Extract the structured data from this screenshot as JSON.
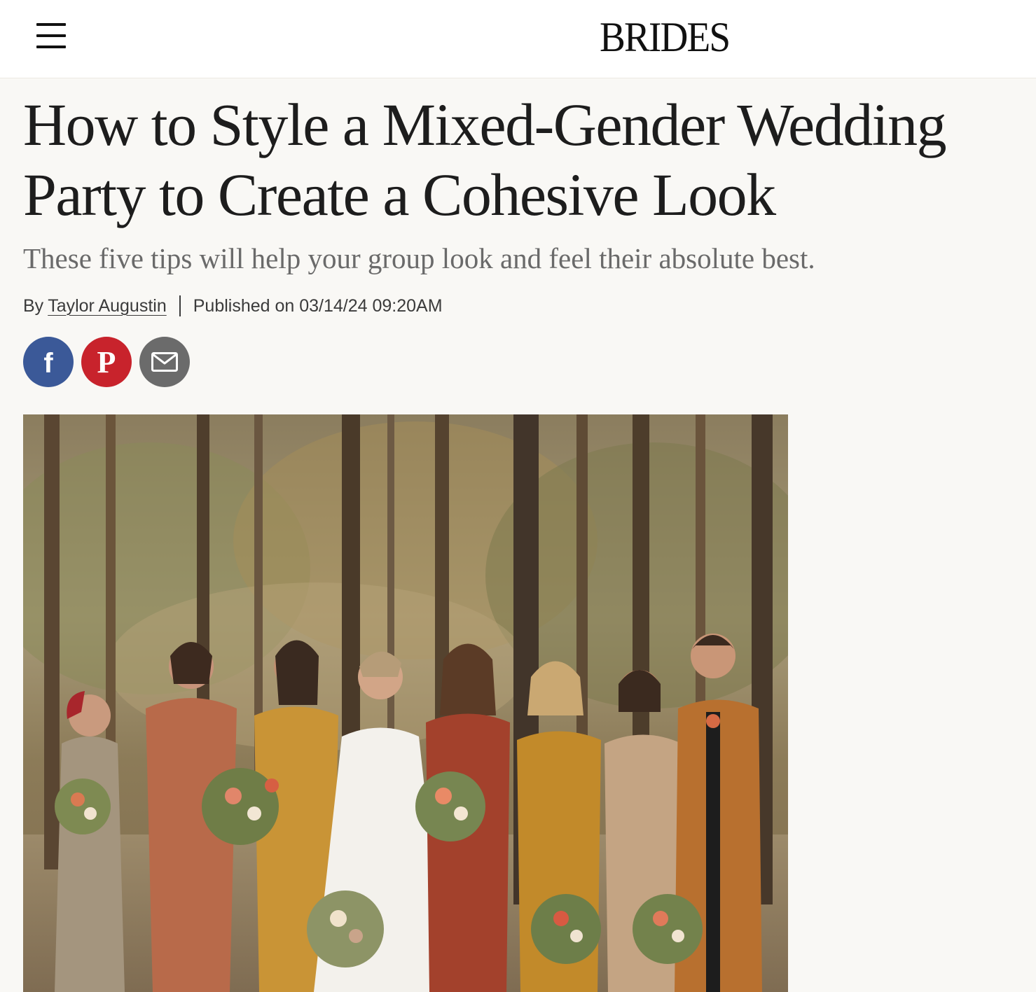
{
  "header": {
    "logo": "BRIDES",
    "menu_icon": "hamburger-menu-icon"
  },
  "article": {
    "title": "How to Style a Mixed-Gender Wedding Party to Create a Cohesive Look",
    "subtitle": "These five tips will help your group look and feel their absolute best.",
    "byline_prefix": "By",
    "author": "Taylor Augustin",
    "published": "Published on 03/14/24 09:20AM"
  },
  "share": [
    {
      "icon": "facebook-icon",
      "color": "#3b5998"
    },
    {
      "icon": "pinterest-icon",
      "color": "#c8232c"
    },
    {
      "icon": "email-icon",
      "color": "#6b6b6b"
    }
  ],
  "colors": {
    "background": "#f9f8f5",
    "header_background": "#ffffff",
    "title": "#1d1d1d",
    "subtitle": "#6a6a6a"
  }
}
